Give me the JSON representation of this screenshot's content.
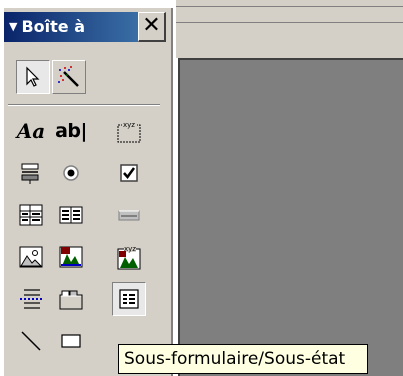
{
  "toolbox": {
    "title": "Boîte à",
    "title_arrow": "▼",
    "close_label": "✕"
  },
  "tools": {
    "label_icon_text": "Aa",
    "textbox_icon_text": "ab|",
    "option_group_icon_text": "xyz"
  },
  "tooltip": {
    "text": "Sous-formulaire/Sous-état"
  },
  "colors": {
    "titlebar": "#0a246a",
    "panel": "#d4d0c8",
    "workspace": "#7f7f7f",
    "tooltip": "#ffffe1"
  }
}
